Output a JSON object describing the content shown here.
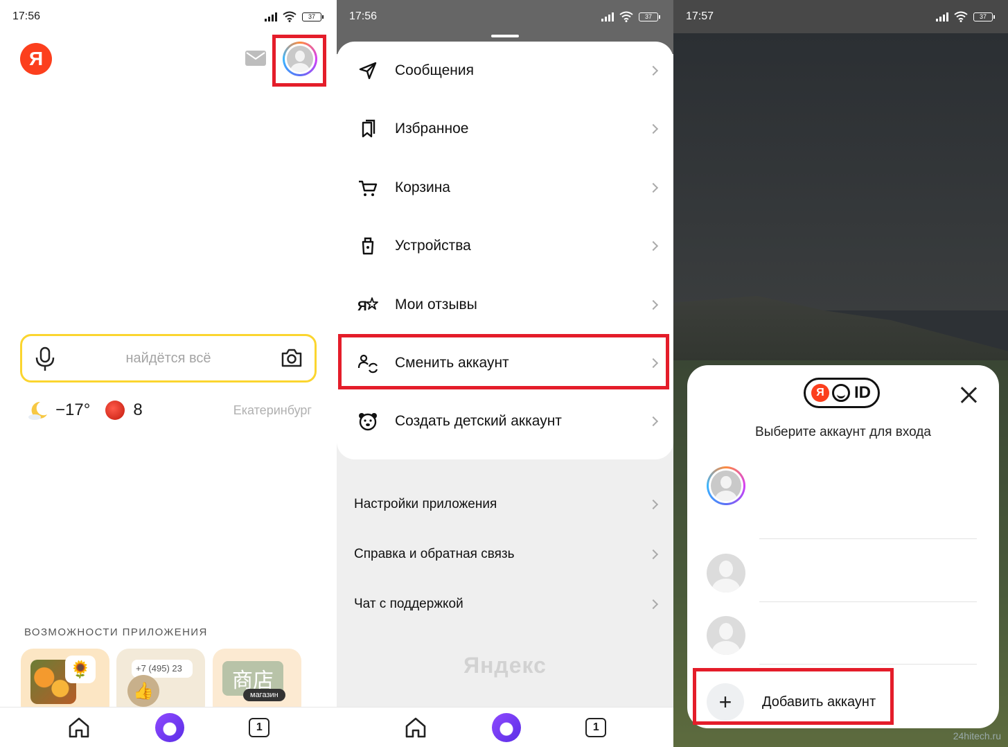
{
  "panel1": {
    "status": {
      "time": "17:56",
      "battery": "37"
    },
    "logo_letter": "Я",
    "search": {
      "placeholder": "найдётся всё"
    },
    "weather": {
      "temperature": "−17°",
      "traffic_score": "8",
      "city": "Екатеринбург"
    },
    "features": {
      "title": "ВОЗМОЖНОСТИ ПРИЛОЖЕНИЯ",
      "cards": [
        {
          "icon": "sunflower-icon",
          "text": "🌻"
        },
        {
          "phone": "+7 (495) 23"
        },
        {
          "shop": "商店",
          "badge": "магазин"
        }
      ]
    },
    "nav": {
      "tabs_count": "1"
    }
  },
  "panel2": {
    "status": {
      "time": "17:56",
      "battery": "37"
    },
    "menu": [
      {
        "label": "Сообщения",
        "icon": "send-icon"
      },
      {
        "label": "Избранное",
        "icon": "bookmarks-icon"
      },
      {
        "label": "Корзина",
        "icon": "cart-icon"
      },
      {
        "label": "Устройства",
        "icon": "device-icon"
      },
      {
        "label": "Мои отзывы",
        "icon": "reviews-icon"
      },
      {
        "label": "Сменить аккаунт",
        "icon": "switch-account-icon"
      },
      {
        "label": "Создать детский аккаунт",
        "icon": "bear-icon"
      }
    ],
    "settings": [
      {
        "label": "Настройки приложения"
      },
      {
        "label": "Справка и обратная связь"
      },
      {
        "label": "Чат с поддержкой"
      }
    ],
    "brand": "Яндекс",
    "nav": {
      "tabs_count": "1"
    }
  },
  "panel3": {
    "status": {
      "time": "17:57",
      "battery": "37"
    },
    "modal": {
      "logo_ya": "Я",
      "logo_text": "ID",
      "subtitle": "Выберите аккаунт для входа",
      "add_account": "Добавить аккаунт",
      "plus": "+"
    },
    "watermark": "24hitech.ru"
  },
  "colors": {
    "highlight": "#e41d2a",
    "search_border": "#fbd52f",
    "yandex_red": "#fc3f1d",
    "alice": "#7a3cf5"
  }
}
